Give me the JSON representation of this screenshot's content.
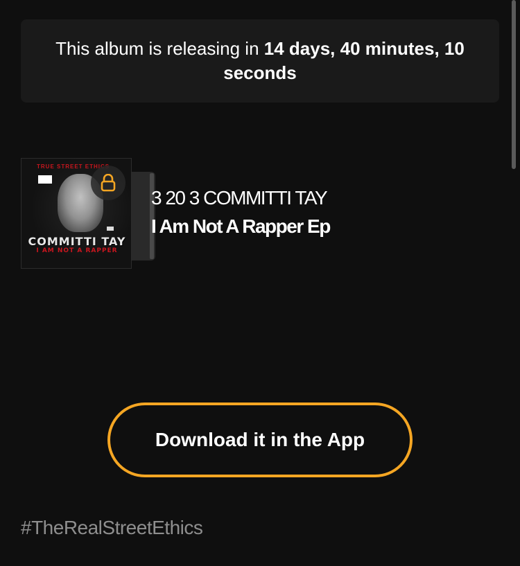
{
  "countdown": {
    "prefix": "This album is releasing in",
    "time_remaining": "14 days, 40 minutes, 10 seconds"
  },
  "album": {
    "artist": "3 20 3 COMMITTI TAY",
    "title": "I Am Not A Rapper Ep",
    "locked": true,
    "lock_icon": "lock-icon",
    "cover": {
      "top_text": "TRUE STREET ETHICS",
      "title": "COMMITTI TAY",
      "subtitle": "I AM NOT A RAPPER"
    }
  },
  "actions": {
    "download_label": "Download it in the App"
  },
  "footer": {
    "hashtag": "#TheRealStreetEthics"
  },
  "colors": {
    "background": "#0f0f0f",
    "panel": "#1a1a1a",
    "accent": "#f5a623",
    "muted_text": "#8e8e8e"
  }
}
